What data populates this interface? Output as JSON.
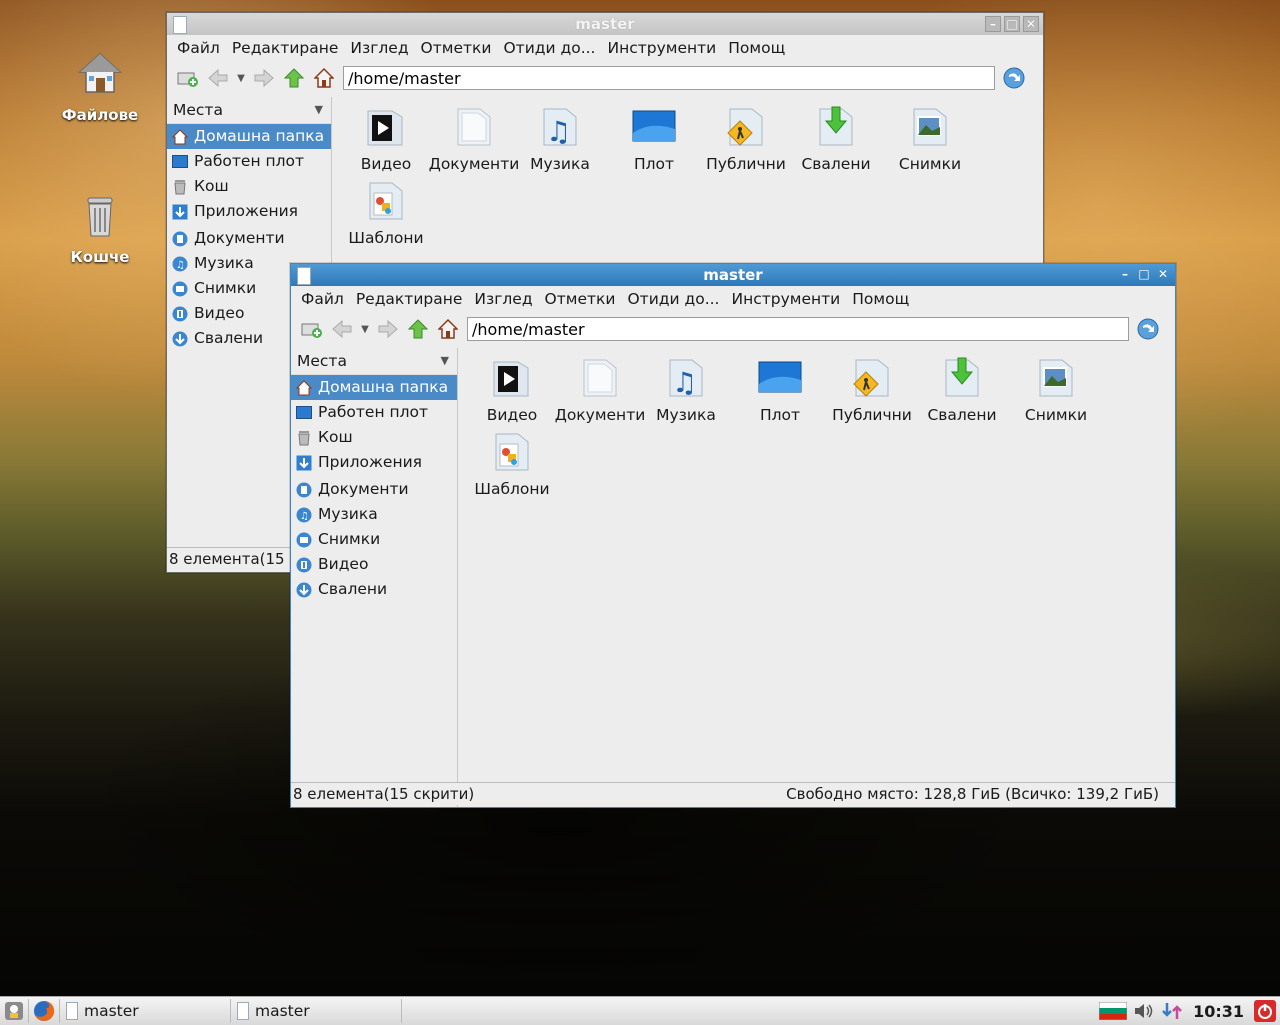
{
  "desktop": {
    "icons": [
      {
        "label": "Файлове",
        "icon": "home-folder-icon"
      },
      {
        "label": "Кошче",
        "icon": "trash-icon"
      }
    ]
  },
  "back_window": {
    "title": "master",
    "menu": [
      "Файл",
      "Редактиране",
      "Изглед",
      "Отметки",
      "Отиди до...",
      "Инструменти",
      "Помощ"
    ],
    "path": "/home/master",
    "places_label": "Места",
    "places": [
      {
        "label": "Домашна папка",
        "icon": "home-icon",
        "selected": true
      },
      {
        "label": "Работен плот",
        "icon": "desktop-icon"
      },
      {
        "label": "Кош",
        "icon": "trash-icon"
      },
      {
        "label": "Приложения",
        "icon": "applications-icon"
      }
    ],
    "bookmarks": [
      {
        "label": "Документи",
        "icon": "documents-icon"
      },
      {
        "label": "Музика",
        "icon": "music-icon"
      },
      {
        "label": "Снимки",
        "icon": "pictures-icon"
      },
      {
        "label": "Видео",
        "icon": "video-icon"
      },
      {
        "label": "Свалени",
        "icon": "downloads-icon"
      }
    ],
    "files": [
      {
        "label": "Видео",
        "icon": "video-folder-icon"
      },
      {
        "label": "Документи",
        "icon": "documents-folder-icon"
      },
      {
        "label": "Музика",
        "icon": "music-folder-icon"
      },
      {
        "label": "Плот",
        "icon": "desktop-folder-icon"
      },
      {
        "label": "Публични",
        "icon": "public-folder-icon"
      },
      {
        "label": "Свалени",
        "icon": "downloads-folder-icon"
      },
      {
        "label": "Снимки",
        "icon": "pictures-folder-icon"
      },
      {
        "label": "Шаблони",
        "icon": "templates-folder-icon"
      }
    ],
    "status_left": "8 елемента(15 с"
  },
  "front_window": {
    "title": "master",
    "menu": [
      "Файл",
      "Редактиране",
      "Изглед",
      "Отметки",
      "Отиди до...",
      "Инструменти",
      "Помощ"
    ],
    "path": "/home/master",
    "places_label": "Места",
    "places": [
      {
        "label": "Домашна папка",
        "icon": "home-icon",
        "selected": true
      },
      {
        "label": "Работен плот",
        "icon": "desktop-icon"
      },
      {
        "label": "Кош",
        "icon": "trash-icon"
      },
      {
        "label": "Приложения",
        "icon": "applications-icon"
      }
    ],
    "bookmarks": [
      {
        "label": "Документи",
        "icon": "documents-icon"
      },
      {
        "label": "Музика",
        "icon": "music-icon"
      },
      {
        "label": "Снимки",
        "icon": "pictures-icon"
      },
      {
        "label": "Видео",
        "icon": "video-icon"
      },
      {
        "label": "Свалени",
        "icon": "downloads-icon"
      }
    ],
    "files": [
      {
        "label": "Видео",
        "icon": "video-folder-icon"
      },
      {
        "label": "Документи",
        "icon": "documents-folder-icon"
      },
      {
        "label": "Музика",
        "icon": "music-folder-icon"
      },
      {
        "label": "Плот",
        "icon": "desktop-folder-icon"
      },
      {
        "label": "Публични",
        "icon": "public-folder-icon"
      },
      {
        "label": "Свалени",
        "icon": "downloads-folder-icon"
      },
      {
        "label": "Снимки",
        "icon": "pictures-folder-icon"
      },
      {
        "label": "Шаблони",
        "icon": "templates-folder-icon"
      }
    ],
    "status_left": "8 елемента(15 скрити)",
    "status_right": "Свободно място: 128,8 ГиБ (Всичко: 139,2 ГиБ)"
  },
  "taskbar": {
    "tasks": [
      "master",
      "master"
    ],
    "clock": "10:31"
  },
  "colors": {
    "accent": "#4a8ac6",
    "titlebar_active": "#3a86c4",
    "selection": "#4a8ac6"
  }
}
